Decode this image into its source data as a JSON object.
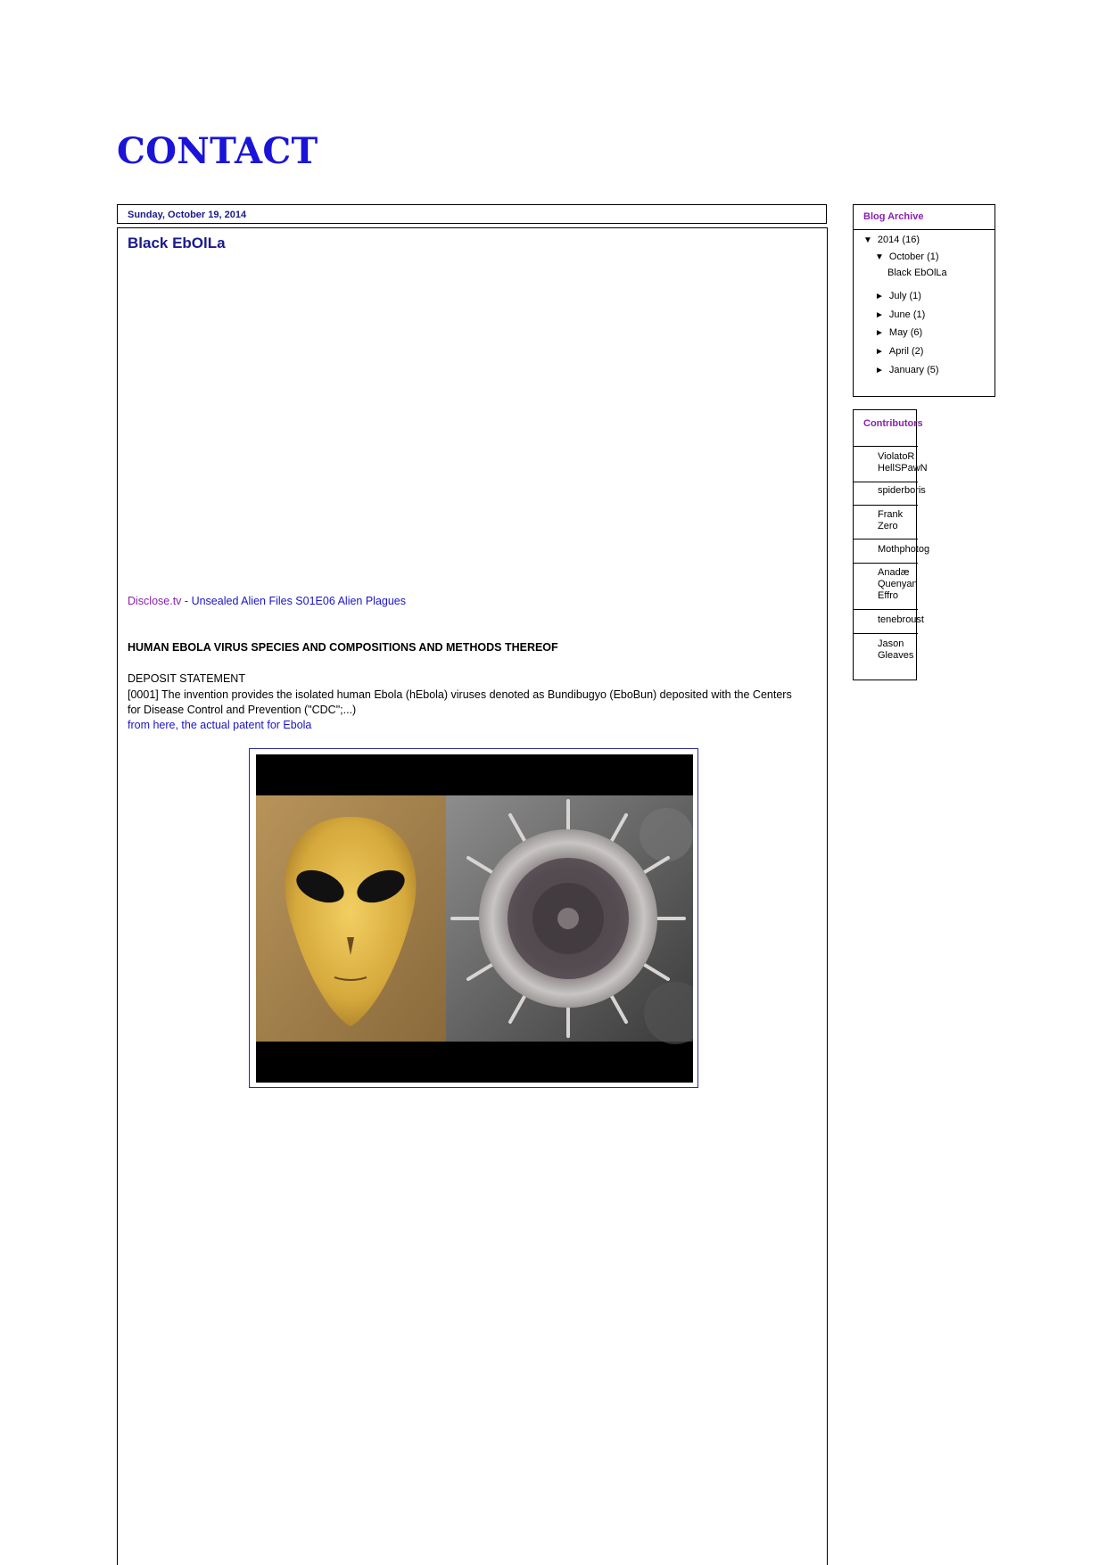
{
  "blog": {
    "title": "CONTACT"
  },
  "post": {
    "date": "Sunday, October 19, 2014",
    "title": "Black EbOlLa",
    "video_source": "Disclose.tv",
    "video_separator": "-",
    "video_title": "Unsealed Alien Files S01E06 Alien Plagues",
    "patent_heading": "HUMAN EBOLA VIRUS SPECIES AND COMPOSITIONS AND METHODS THEREOF",
    "deposit_heading": "DEPOSIT STATEMENT",
    "deposit_text": "[0001] The invention provides the isolated human Ebola (hEbola) viruses denoted as Bundibugyo (EboBun) deposited with the Centers for Disease Control and Prevention (\"CDC\";...)",
    "patent_link": "from here, the actual patent for Ebola"
  },
  "sidebar": {
    "archive": {
      "title": "Blog Archive",
      "year": {
        "arrow": "▼",
        "label": "2014 (16)"
      },
      "current_month": {
        "arrow": "▼",
        "label": "October (1)"
      },
      "current_post": "Black EbOlLa",
      "months": [
        {
          "arrow": "►",
          "label": "July (1)"
        },
        {
          "arrow": "►",
          "label": "June (1)"
        },
        {
          "arrow": "►",
          "label": "May (6)"
        },
        {
          "arrow": "►",
          "label": "April (2)"
        },
        {
          "arrow": "►",
          "label": "January (5)"
        }
      ]
    },
    "contributors": {
      "title": "Contributors",
      "names": [
        "ViolatoR HellSPawN",
        "spiderboris",
        "Frank Zero",
        "Mothphotog",
        "Anadæ Quenyan Effro",
        "tenebroust",
        "Jason Gleaves"
      ]
    }
  },
  "colors": {
    "title_blue": "#1a14d9",
    "link_blue": "#1a14c8",
    "visited_purple": "#8b1fb0",
    "dark_navy": "#1a1a8c"
  }
}
